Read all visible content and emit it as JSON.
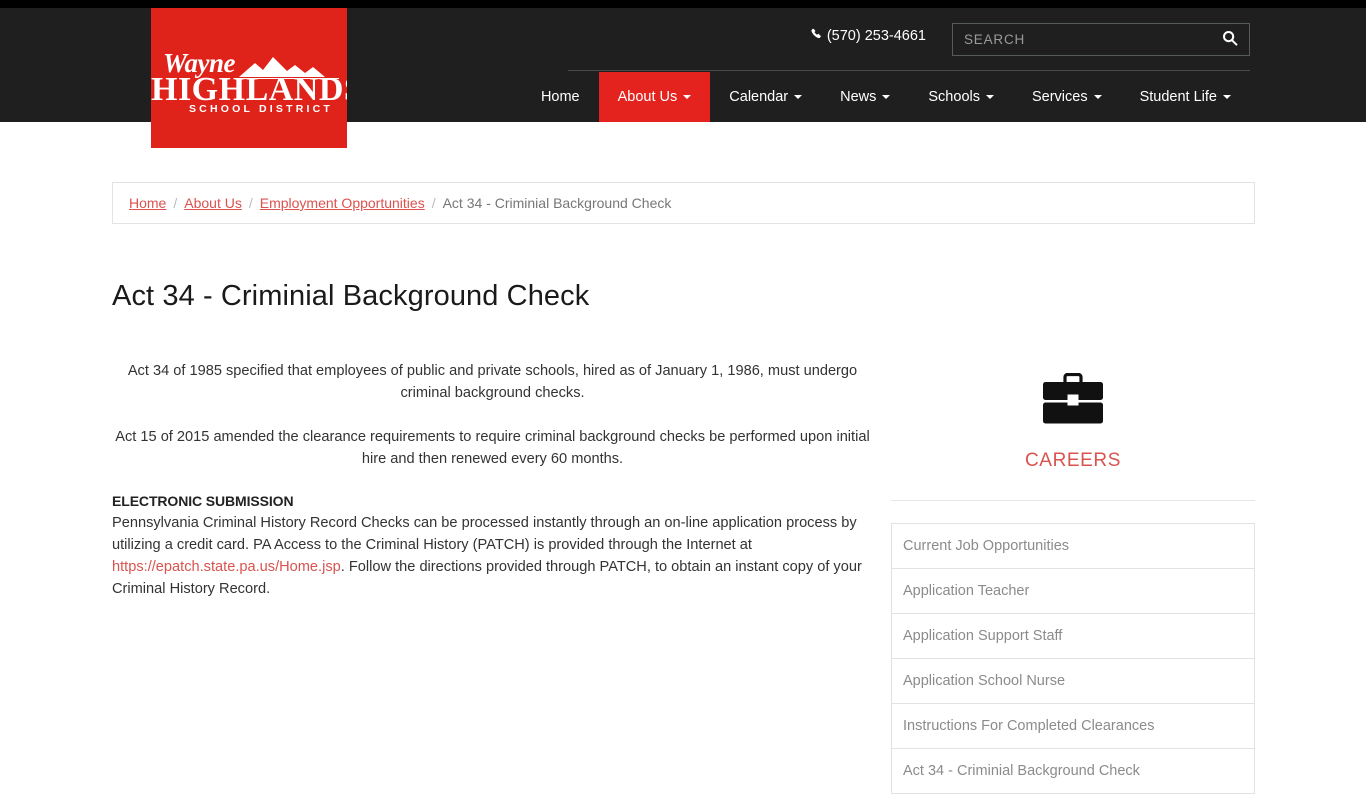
{
  "header": {
    "logo": {
      "line1": "Wayne",
      "line2": "HIGHLANDS",
      "line3": "SCHOOL DISTRICT",
      "bg_color": "#e0231a"
    },
    "phone": "(570) 253-4661",
    "phone_icon": "phone-icon",
    "search": {
      "placeholder": "SEARCH",
      "value": "",
      "icon": "search-icon"
    },
    "nav": [
      {
        "label": "Home",
        "has_caret": false,
        "active": false
      },
      {
        "label": "About Us",
        "has_caret": true,
        "active": true
      },
      {
        "label": "Calendar",
        "has_caret": true,
        "active": false
      },
      {
        "label": "News",
        "has_caret": true,
        "active": false
      },
      {
        "label": "Schools",
        "has_caret": true,
        "active": false
      },
      {
        "label": "Services",
        "has_caret": true,
        "active": false
      },
      {
        "label": "Student Life",
        "has_caret": true,
        "active": false
      }
    ],
    "accent_color": "#e5231e",
    "bar_color": "#1f1f1f"
  },
  "breadcrumb": [
    {
      "label": "Home",
      "link": true
    },
    {
      "label": "About Us",
      "link": true
    },
    {
      "label": "Employment Opportunities",
      "link": true
    },
    {
      "label": "Act 34 - Criminial Background Check",
      "link": false
    }
  ],
  "page": {
    "title": "Act 34 - Criminial Background Check",
    "intro_paragraph_1": "Act 34 of 1985 specified that employees of public and private schools, hired as of January 1, 1986, must undergo criminal background checks.",
    "intro_paragraph_2": "Act 15 of 2015 amended the clearance requirements to require criminal background checks be performed upon initial hire and then renewed every 60 months.",
    "section_heading": "ELECTRONIC SUBMISSION",
    "section_body_before_link": "Pennsylvania Criminal History Record Checks can be processed instantly through an on-line application process by utilizing a credit card. PA Access to the Criminal History (PATCH) is provided through the Internet at ",
    "section_link_text": "https://epatch.state.pa.us/Home.jsp",
    "section_body_after_link": ". Follow the directions provided through PATCH, to obtain an instant copy of your Criminal History Record."
  },
  "sidebar": {
    "careers_icon": "briefcase-icon",
    "careers_label": "CAREERS",
    "careers_color": "#d9534f",
    "links": [
      {
        "label": "Current Job Opportunities"
      },
      {
        "label": "Application Teacher"
      },
      {
        "label": "Application Support Staff"
      },
      {
        "label": "Application School Nurse"
      },
      {
        "label": "Instructions For Completed Clearances"
      },
      {
        "label": "Act 34 - Criminial Background Check"
      }
    ]
  }
}
